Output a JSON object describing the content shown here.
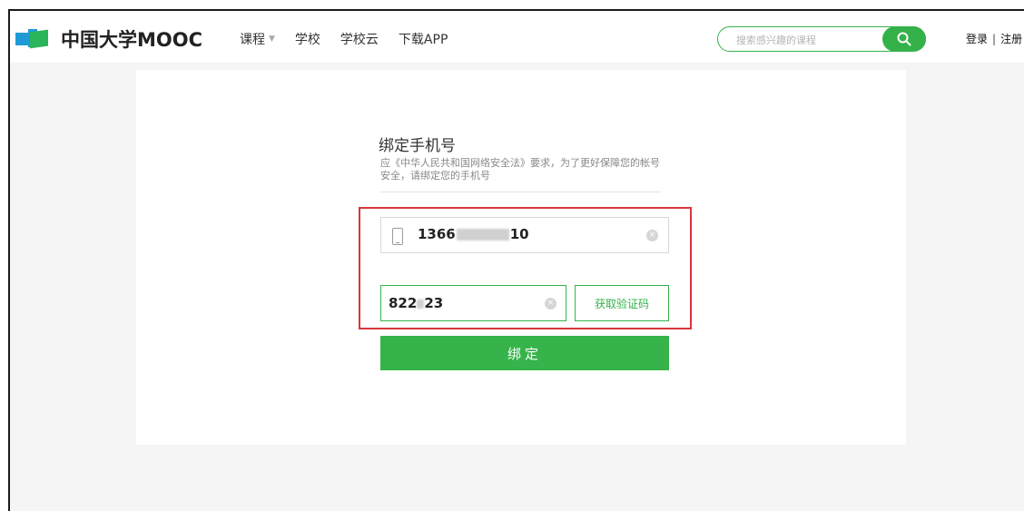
{
  "header": {
    "logo_text": "中国大学MOOC",
    "nav": [
      {
        "label": "课程",
        "has_dropdown": true
      },
      {
        "label": "学校"
      },
      {
        "label": "学校云"
      },
      {
        "label": "下载APP"
      }
    ],
    "search": {
      "placeholder": "搜索感兴趣的课程",
      "icon": "search-icon"
    },
    "login_label": "登录",
    "separator": "|",
    "register_label": "注册"
  },
  "bind_form": {
    "title": "绑定手机号",
    "description": "应《中华人民共和国网络安全法》要求，为了更好保障您的帐号安全，请绑定您的手机号",
    "phone": {
      "prefix": "1366",
      "suffix": "10",
      "icon": "mobile-phone-icon"
    },
    "code": {
      "prefix": "822",
      "suffix": "23"
    },
    "get_code_label": "获取验证码",
    "submit_label": "绑定"
  },
  "colors": {
    "accent": "#36b34a",
    "highlight_border": "#d9363e",
    "page_background": "#f5f5f5"
  }
}
